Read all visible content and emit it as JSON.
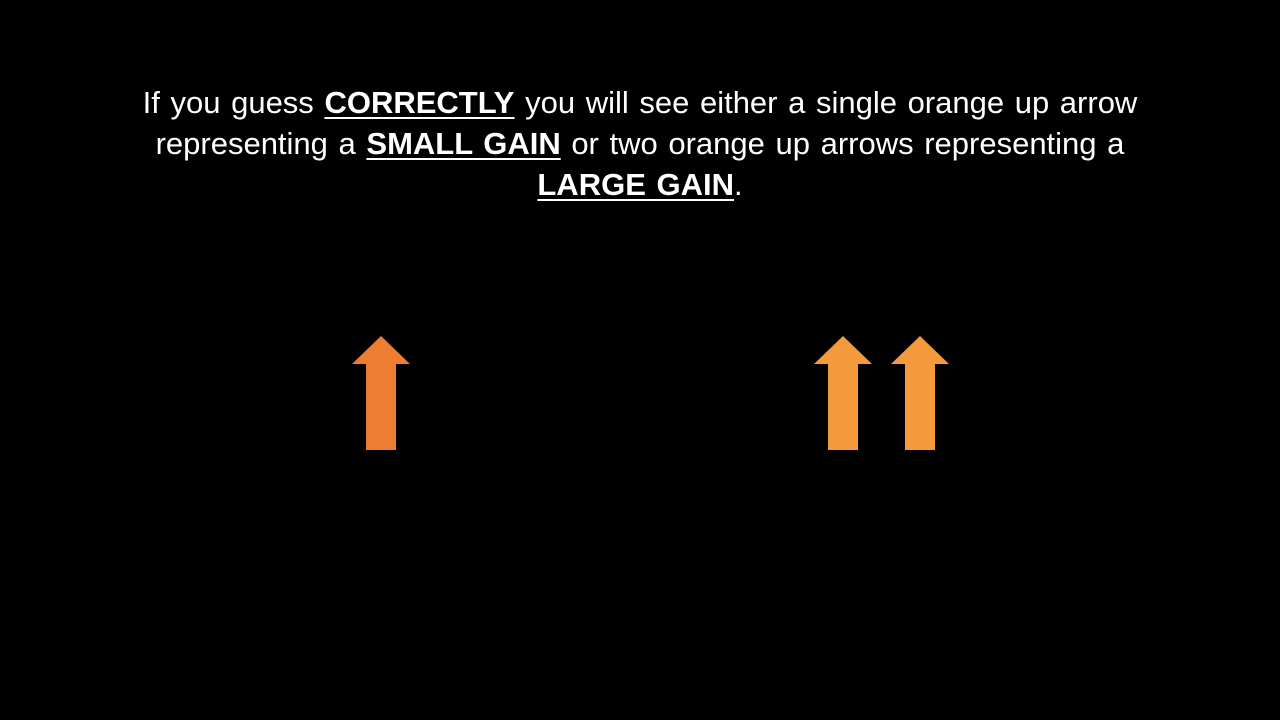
{
  "instruction": {
    "t1": "If you guess ",
    "e1": "CORRECTLY",
    "t2": " you will see either a single orange up arrow representing a ",
    "e2": "SMALL GAIN",
    "t3": " or two orange up arrows representing a ",
    "e3": "LARGE GAIN",
    "t4": "."
  },
  "colors": {
    "background": "#000000",
    "text": "#ffffff",
    "small_gain_arrow": "#ED7D31",
    "large_gain_arrow": "#F59A3C"
  },
  "icons": {
    "small_gain": [
      "up-arrow"
    ],
    "large_gain": [
      "up-arrow",
      "up-arrow"
    ]
  }
}
